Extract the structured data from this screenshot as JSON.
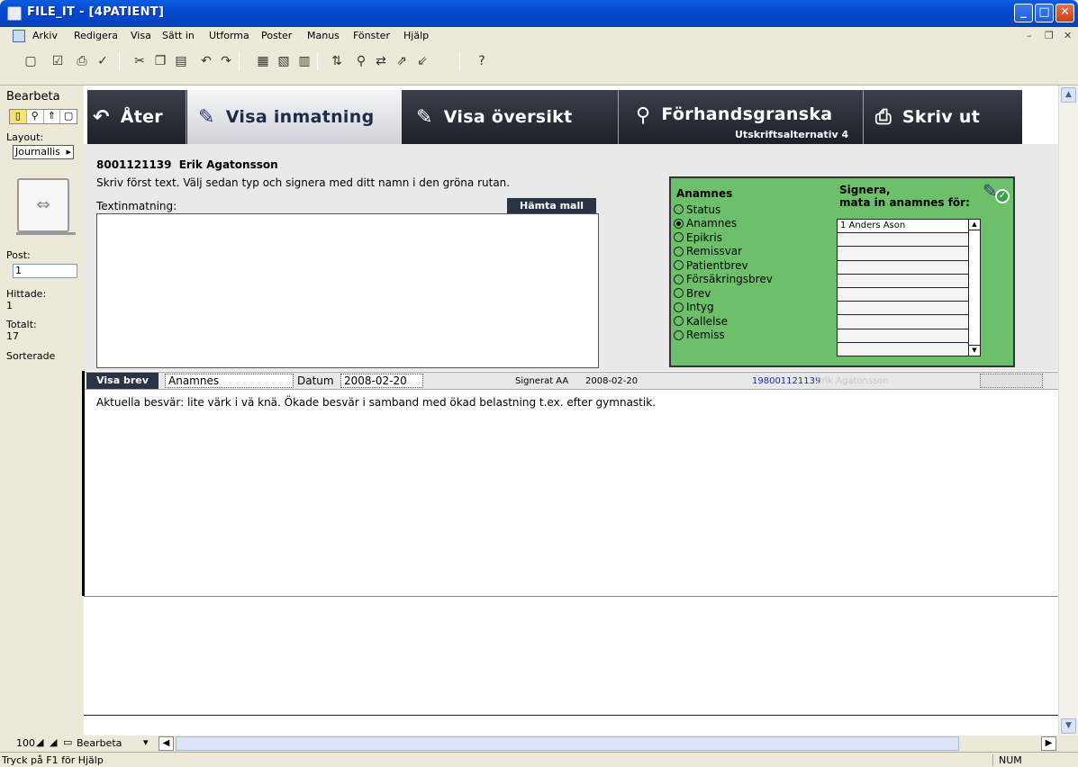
{
  "window": {
    "title": "FILE_IT - [4PATIENT]",
    "controls": {
      "minimize": "_",
      "maximize": "□",
      "close": "✕"
    },
    "mdi_controls": {
      "minimize": "–",
      "restore": "❐",
      "close": "✕"
    }
  },
  "menu": [
    "Arkiv",
    "Redigera",
    "Visa",
    "Sätt in",
    "Utforma",
    "Poster",
    "Manus",
    "Fönster",
    "Hjälp"
  ],
  "toolbar_icons": [
    "new-doc-icon",
    "checkbox-icon",
    "print-icon",
    "spellcheck-icon",
    "cut-icon",
    "copy-icon",
    "paste-icon",
    "undo-icon",
    "redo-icon",
    "new-record-icon",
    "duplicate-record-icon",
    "delete-record-icon",
    "sort-icon",
    "find-icon",
    "replace-icon",
    "export-icon",
    "import-icon",
    "help-icon"
  ],
  "left_pane": {
    "mode": "Bearbeta",
    "layout_label": "Layout:",
    "layout_value": "Journallis",
    "post_label": "Post:",
    "post_value": "1",
    "found_label": "Hittade:",
    "found_value": "1",
    "total_label": "Totalt:",
    "total_value": "17",
    "sorted_label": "Sorterade"
  },
  "nav": {
    "back": "Åter",
    "input": "Visa inmatning",
    "overview": "Visa översikt",
    "preview": "Förhandsgranska",
    "print_options": "Utskriftsalternativ",
    "print_options_count": "4",
    "print": "Skriv ut"
  },
  "patient": {
    "id": "8001121139",
    "name": "Erik Agatonsson",
    "instruction": "Skriv först text. Välj sedan typ och signera med ditt namn i den gröna rutan.",
    "textinput_label": "Textinmatning:",
    "template_button": "Hämta mall",
    "textinput_value": ""
  },
  "sign_box": {
    "type_heading": "Anamnes",
    "sign_heading_1": "Signera,",
    "sign_heading_2": "mata in anamnes för:",
    "types": [
      {
        "label": "Status",
        "selected": false
      },
      {
        "label": "Anamnes",
        "selected": true
      },
      {
        "label": "Epikris",
        "selected": false
      },
      {
        "label": "Remissvar",
        "selected": false
      },
      {
        "label": "Patientbrev",
        "selected": false
      },
      {
        "label": "Försäkringsbrev",
        "selected": false
      },
      {
        "label": "Brev",
        "selected": false
      },
      {
        "label": "Intyg",
        "selected": false
      },
      {
        "label": "Kallelse",
        "selected": false
      },
      {
        "label": "Remiss",
        "selected": false
      }
    ],
    "signers": [
      "1   Anders Ason",
      "",
      "",
      "",
      "",
      "",
      "",
      "",
      "",
      ""
    ]
  },
  "record": {
    "show_letter": "Visa brev",
    "type": "Anamnes",
    "date_label": "Datum",
    "date": "2008-02-20",
    "signed_label": "Signerat AA",
    "signed_date": "2008-02-20",
    "pid": "198001121139",
    "name": "Erik Agatonsson",
    "note": "Aktuella besvär: lite värk i vä knä. Ökade besvär i samband med ökad belastning t.ex. efter gymnastik."
  },
  "bottom": {
    "zoom": "100",
    "mode": "Bearbeta"
  },
  "status": {
    "help": "Tryck på F1 för Hjälp",
    "num": "NUM"
  },
  "colors": {
    "accent_green": "#6cc06a",
    "nav_dark": "#1c2028",
    "button_dark": "#2a3447",
    "title_blue": "#0549cf"
  }
}
